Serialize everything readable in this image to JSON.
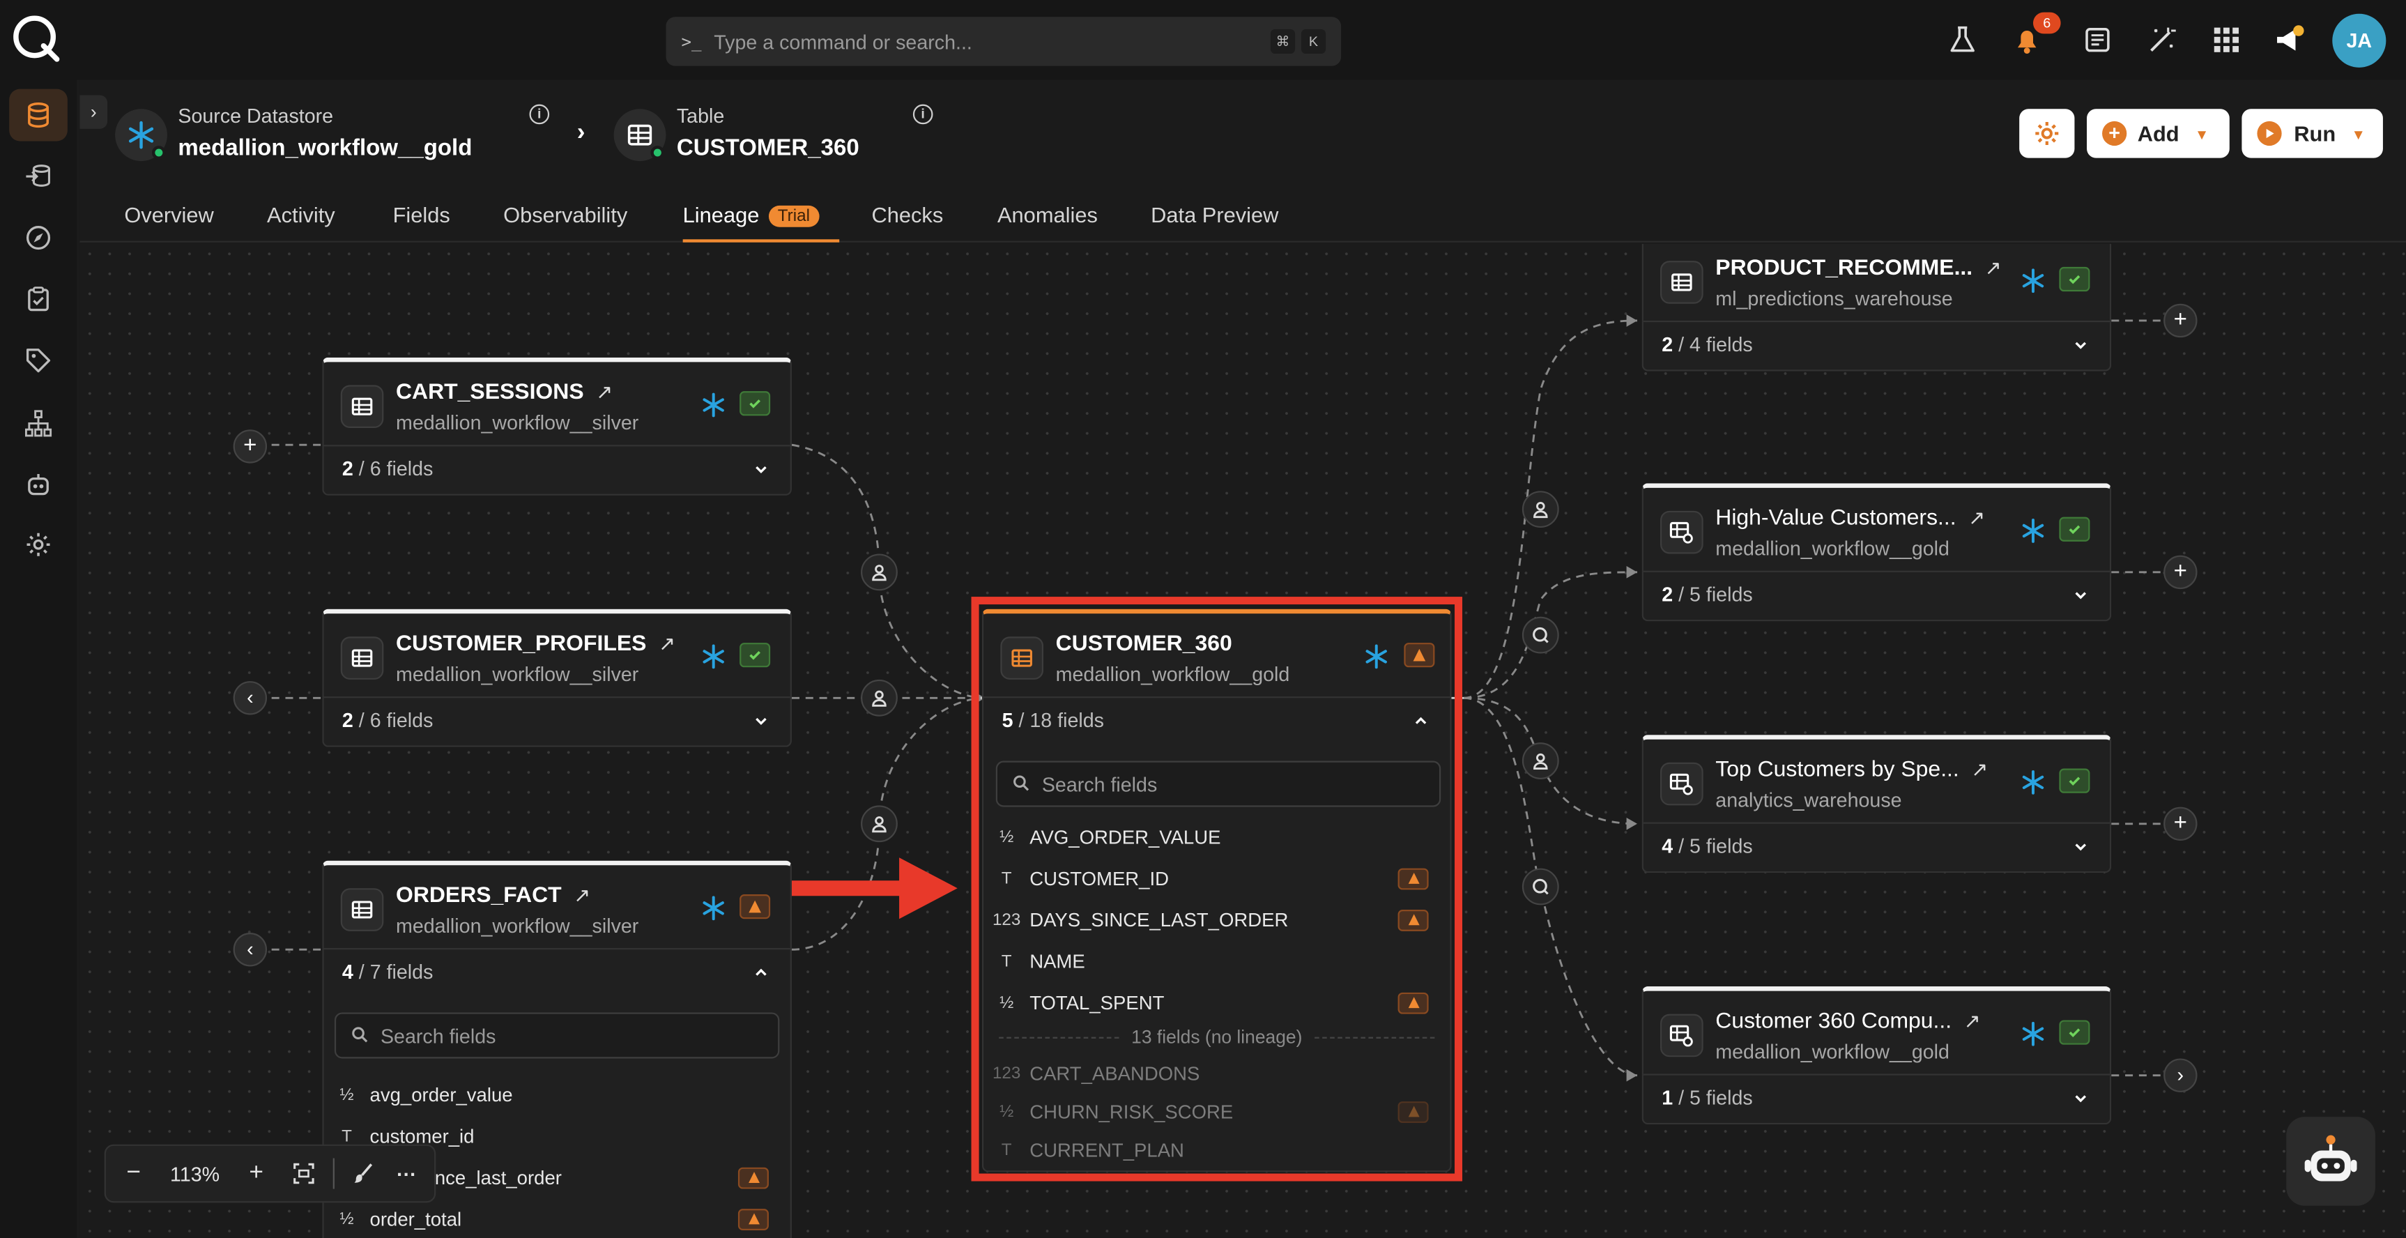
{
  "topbar": {
    "command_placeholder": "Type a command or search...",
    "shortcut_cmd": "⌘",
    "shortcut_key": "K",
    "notification_count": "6",
    "avatar_initials": "JA",
    "icons": [
      "flask-icon",
      "bell-icon",
      "notes-icon",
      "magic-icon",
      "apps-grid-icon",
      "megaphone-icon"
    ]
  },
  "sidebar": {
    "items": [
      "database-icon",
      "flow-icon",
      "compass-icon",
      "checklist-icon",
      "tag-icon",
      "hierarchy-icon",
      "robot-icon",
      "gear-icon"
    ],
    "active": "database-icon"
  },
  "breadcrumb": {
    "source_label": "Source Datastore",
    "source_value": "medallion_workflow__gold",
    "table_label": "Table",
    "table_value": "CUSTOMER_360"
  },
  "actions": {
    "settings": "gear-icon",
    "add_label": "Add",
    "run_label": "Run"
  },
  "tabs": [
    {
      "label": "Overview"
    },
    {
      "label": "Activity"
    },
    {
      "label": "Fields"
    },
    {
      "label": "Observability"
    },
    {
      "label": "Lineage",
      "badge": "Trial",
      "active": true
    },
    {
      "label": "Checks"
    },
    {
      "label": "Anomalies"
    },
    {
      "label": "Data Preview"
    }
  ],
  "lineage": {
    "upstream": [
      {
        "title": "CART_SESSIONS",
        "datastore": "medallion_workflow__silver",
        "shown": "2",
        "total": " / 6 fields",
        "status": "ok"
      },
      {
        "title": "CUSTOMER_PROFILES",
        "datastore": "medallion_workflow__silver",
        "shown": "2",
        "total": " / 6 fields",
        "status": "ok"
      },
      {
        "title": "ORDERS_FACT",
        "datastore": "medallion_workflow__silver",
        "shown": "4",
        "total": " / 7 fields",
        "status": "warning",
        "search_placeholder": "Search fields",
        "fields": [
          {
            "type": "½",
            "name": "avg_order_value",
            "warn": false
          },
          {
            "type": "T",
            "name": "customer_id",
            "warn": false
          },
          {
            "type": "123",
            "name": "days_since_last_order",
            "warn": true
          },
          {
            "type": "½",
            "name": "order_total",
            "warn": true
          }
        ]
      }
    ],
    "focus": {
      "title": "CUSTOMER_360",
      "datastore": "medallion_workflow__gold",
      "shown": "5",
      "total": " / 18 fields",
      "status": "warning",
      "search_placeholder": "Search fields",
      "fields": [
        {
          "type": "½",
          "name": "AVG_ORDER_VALUE",
          "warn": false
        },
        {
          "type": "T",
          "name": "CUSTOMER_ID",
          "warn": true
        },
        {
          "type": "123",
          "name": "DAYS_SINCE_LAST_ORDER",
          "warn": true
        },
        {
          "type": "T",
          "name": "NAME",
          "warn": false
        },
        {
          "type": "½",
          "name": "TOTAL_SPENT",
          "warn": true
        }
      ],
      "no_lineage_label": "13 fields (no lineage)",
      "no_lineage_fields": [
        {
          "type": "123",
          "name": "CART_ABANDONS",
          "warn": false
        },
        {
          "type": "½",
          "name": "CHURN_RISK_SCORE",
          "warn": true
        },
        {
          "type": "T",
          "name": "CURRENT_PLAN",
          "warn": false
        }
      ]
    },
    "downstream": [
      {
        "title": "PRODUCT_RECOMME...",
        "datastore": "ml_predictions_warehouse",
        "shown": "2",
        "total": " / 4 fields",
        "status": "ok",
        "kind": "table"
      },
      {
        "title": "High-Value Customers...",
        "datastore": "medallion_workflow__gold",
        "shown": "2",
        "total": " / 5 fields",
        "status": "ok",
        "kind": "computed"
      },
      {
        "title": "Top Customers by Spe...",
        "datastore": "analytics_warehouse",
        "shown": "4",
        "total": " / 5 fields",
        "status": "ok",
        "kind": "computed"
      },
      {
        "title": "Customer 360 Compu...",
        "datastore": "medallion_workflow__gold",
        "shown": "1",
        "total": " / 5 fields",
        "status": "ok",
        "kind": "computed"
      }
    ]
  },
  "zoom": {
    "level": "113%"
  },
  "colors": {
    "accent": "#f08a32",
    "highlight": "#e8392a",
    "ok": "#3f7a38",
    "warn": "#e8752a",
    "snowflake": "#29a3e0"
  }
}
